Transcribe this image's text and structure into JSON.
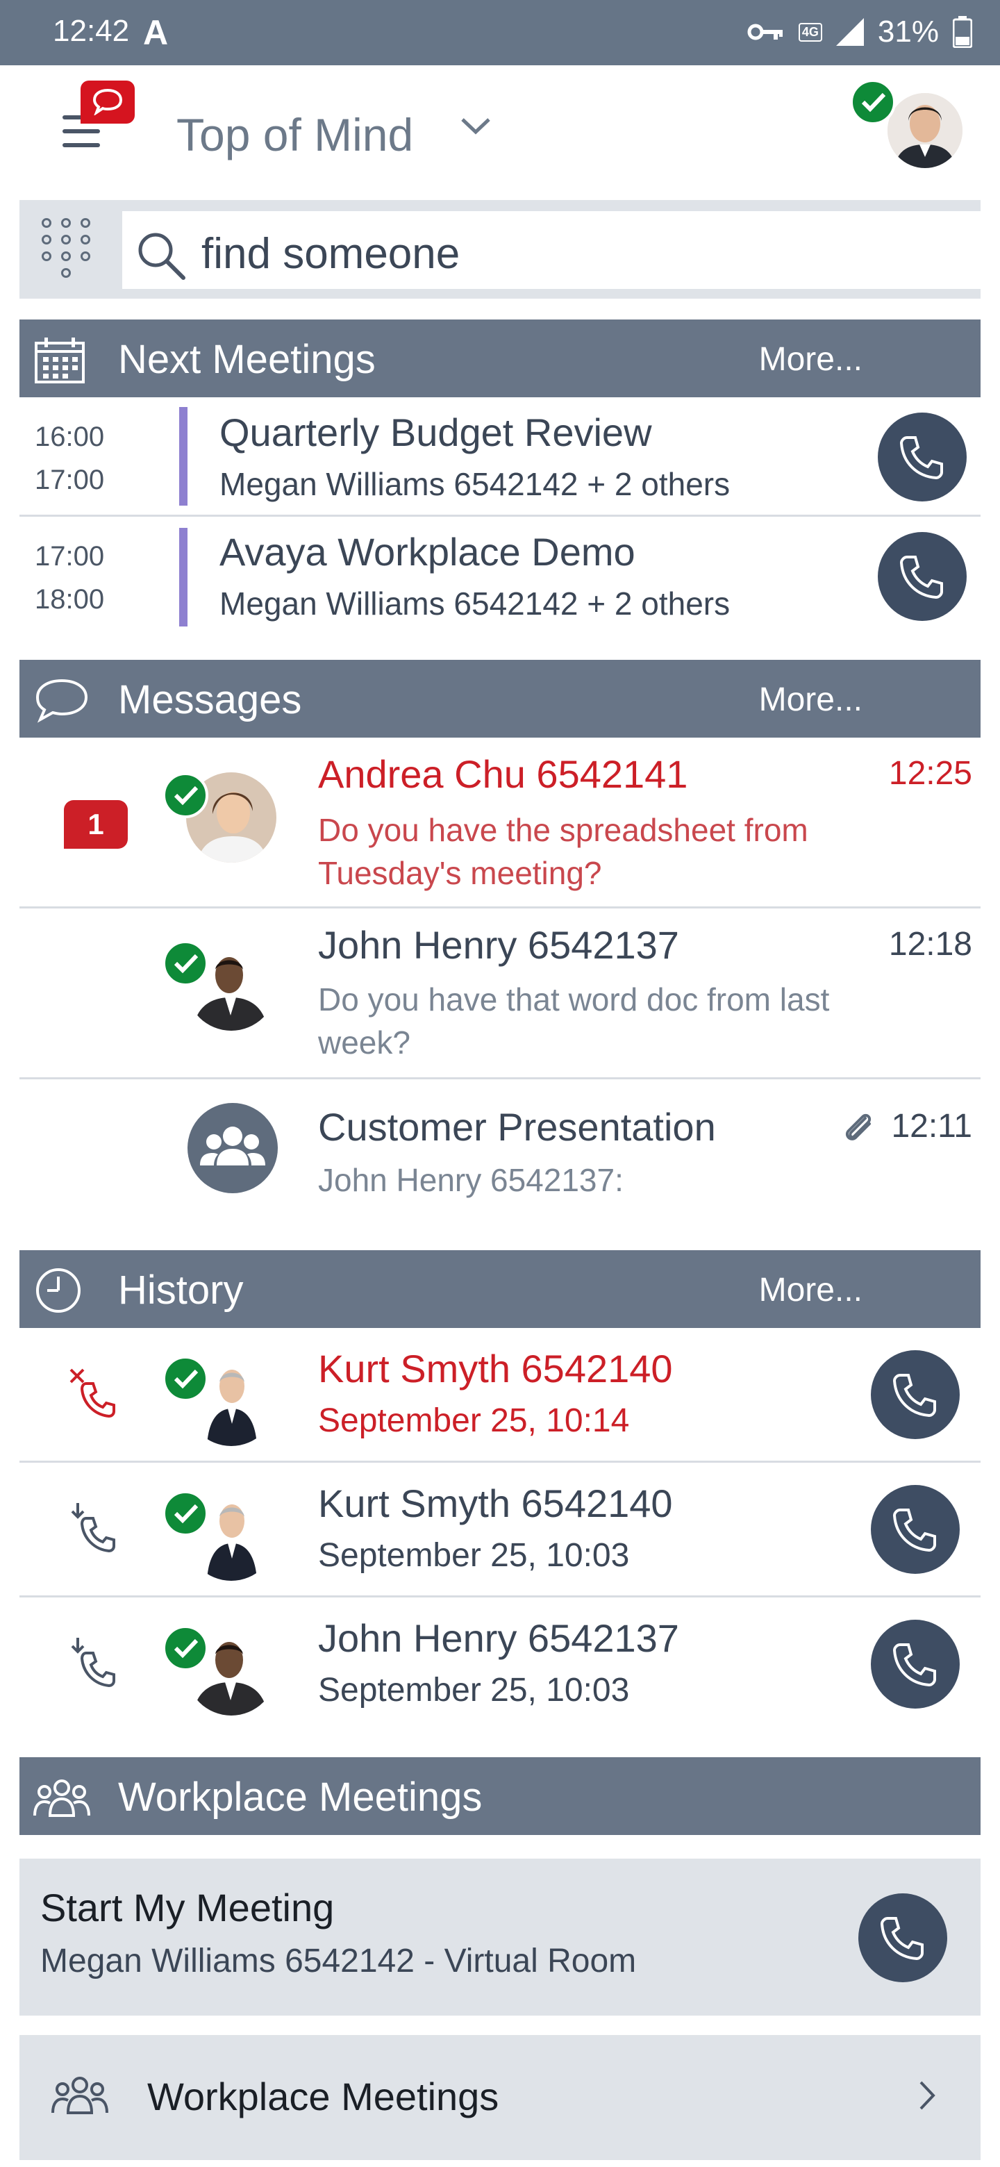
{
  "status_bar": {
    "time": "12:42",
    "network_badge": "4G",
    "battery": "31%"
  },
  "header": {
    "title": "Top of Mind"
  },
  "search": {
    "placeholder": "find someone"
  },
  "next_meetings": {
    "title": "Next Meetings",
    "more": "More...",
    "items": [
      {
        "start": "16:00",
        "end": "17:00",
        "title": "Quarterly Budget Review",
        "subtitle": "Megan Williams 6542142 + 2 others"
      },
      {
        "start": "17:00",
        "end": "18:00",
        "title": "Avaya Workplace Demo",
        "subtitle": "Megan Williams 6542142 + 2 others"
      }
    ]
  },
  "messages": {
    "title": "Messages",
    "more": "More...",
    "items": [
      {
        "name": "Andrea Chu 6542141",
        "time": "12:25",
        "text": "Do you have the spreadsheet from Tuesday's meeting?",
        "unread": "1"
      },
      {
        "name": "John Henry 6542137",
        "time": "12:18",
        "text": "Do you have that word doc from last week?"
      },
      {
        "name": "Customer Presentation",
        "time": "12:11",
        "text": "John Henry 6542137:"
      }
    ]
  },
  "history": {
    "title": "History",
    "more": "More...",
    "items": [
      {
        "name": "Kurt Smyth 6542140",
        "date": "September 25, 10:14",
        "type": "missed"
      },
      {
        "name": "Kurt Smyth 6542140",
        "date": "September 25, 10:03",
        "type": "incoming"
      },
      {
        "name": "John Henry 6542137",
        "date": "September 25, 10:03",
        "type": "incoming"
      }
    ]
  },
  "workplace_meetings": {
    "title": "Workplace Meetings",
    "start_title": "Start My Meeting",
    "start_subtitle": "Megan Williams 6542142 - Virtual Room",
    "link_label": "Workplace Meetings"
  },
  "colors": {
    "header_bg": "#687587",
    "missed_red": "#cc1f27",
    "presence_green": "#0e8a38",
    "call_button": "#3e4d63",
    "meeting_bar": "#8e80d0"
  }
}
